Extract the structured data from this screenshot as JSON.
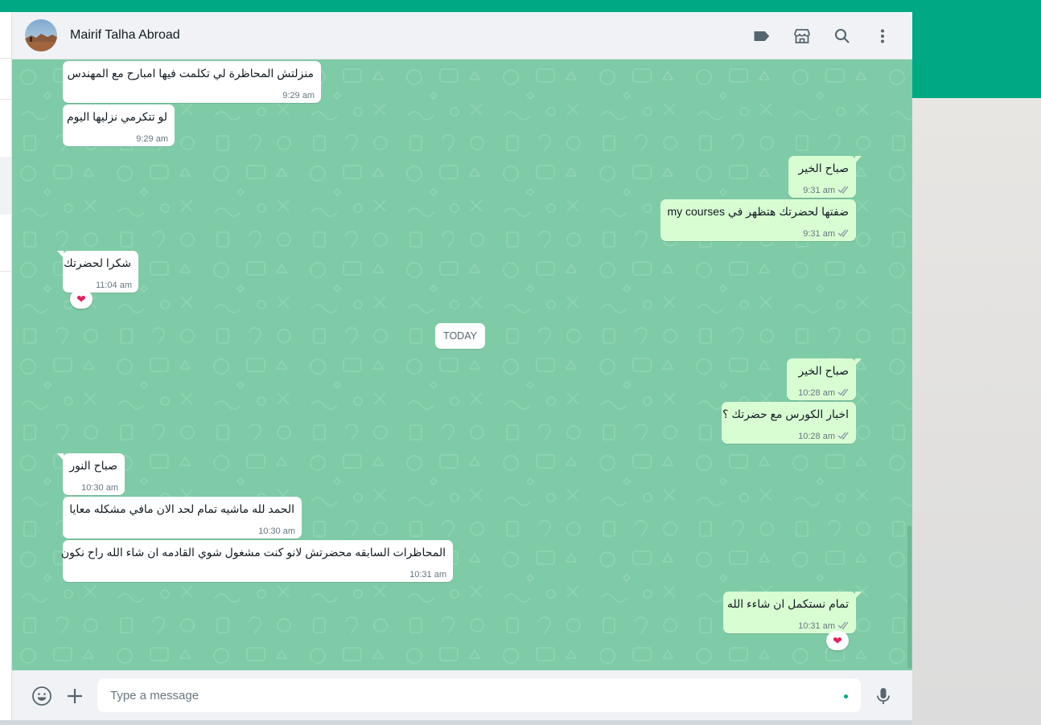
{
  "header": {
    "contact_name": "Mairif Talha Abroad",
    "icons": [
      "label-icon",
      "catalog-icon",
      "search-icon",
      "menu-icon"
    ]
  },
  "messages": [
    {
      "dir": "in",
      "text": "منزلتش المحاظرة لي تكلمت فيها امبارح مع المهندس",
      "time": "9:29 am"
    },
    {
      "dir": "in",
      "text": "لو تتكرمي نزليها اليوم",
      "time": "9:29 am"
    },
    {
      "dir": "out",
      "text": "صباح الخير",
      "time": "9:31 am",
      "status": "read"
    },
    {
      "dir": "out",
      "text": "ضفتها لحضرتك هتظهر في my courses",
      "time": "9:31 am",
      "status": "read"
    },
    {
      "dir": "in",
      "text": "شكرا لحضرتك",
      "time": "11:04 am",
      "reaction": "❤"
    },
    {
      "dir": "out",
      "text": "صباح الخير",
      "time": "10:28 am",
      "status": "read"
    },
    {
      "dir": "out",
      "text": "اخبار الكورس مع حضرتك ؟",
      "time": "10:28 am",
      "status": "read"
    },
    {
      "dir": "in",
      "text": "صباح النور",
      "time": "10:30 am"
    },
    {
      "dir": "in",
      "text": "الحمد لله ماشيه تمام لحد الان مافي  مشكله معايا",
      "time": "10:30 am"
    },
    {
      "dir": "in",
      "text": "المحاظرات السابقه محضرتش لانو كنت مشغول شوي القادمه ان شاء  الله راح نكون",
      "time": "10:31 am"
    },
    {
      "dir": "out",
      "text": "تمام نستكمل ان شاءء الله",
      "time": "10:31 am",
      "status": "read",
      "reaction": "❤"
    }
  ],
  "day_separator": "TODAY",
  "footer": {
    "placeholder": "Type a message",
    "icons": [
      "emoji-icon",
      "attach-icon",
      "microphone-icon"
    ]
  },
  "colors": {
    "brand": "#00a884",
    "chat_background": "#7fcba7",
    "incoming_bubble": "#ffffff",
    "outgoing_bubble": "#d9fdd3",
    "read_ticks": "#8696a0"
  }
}
